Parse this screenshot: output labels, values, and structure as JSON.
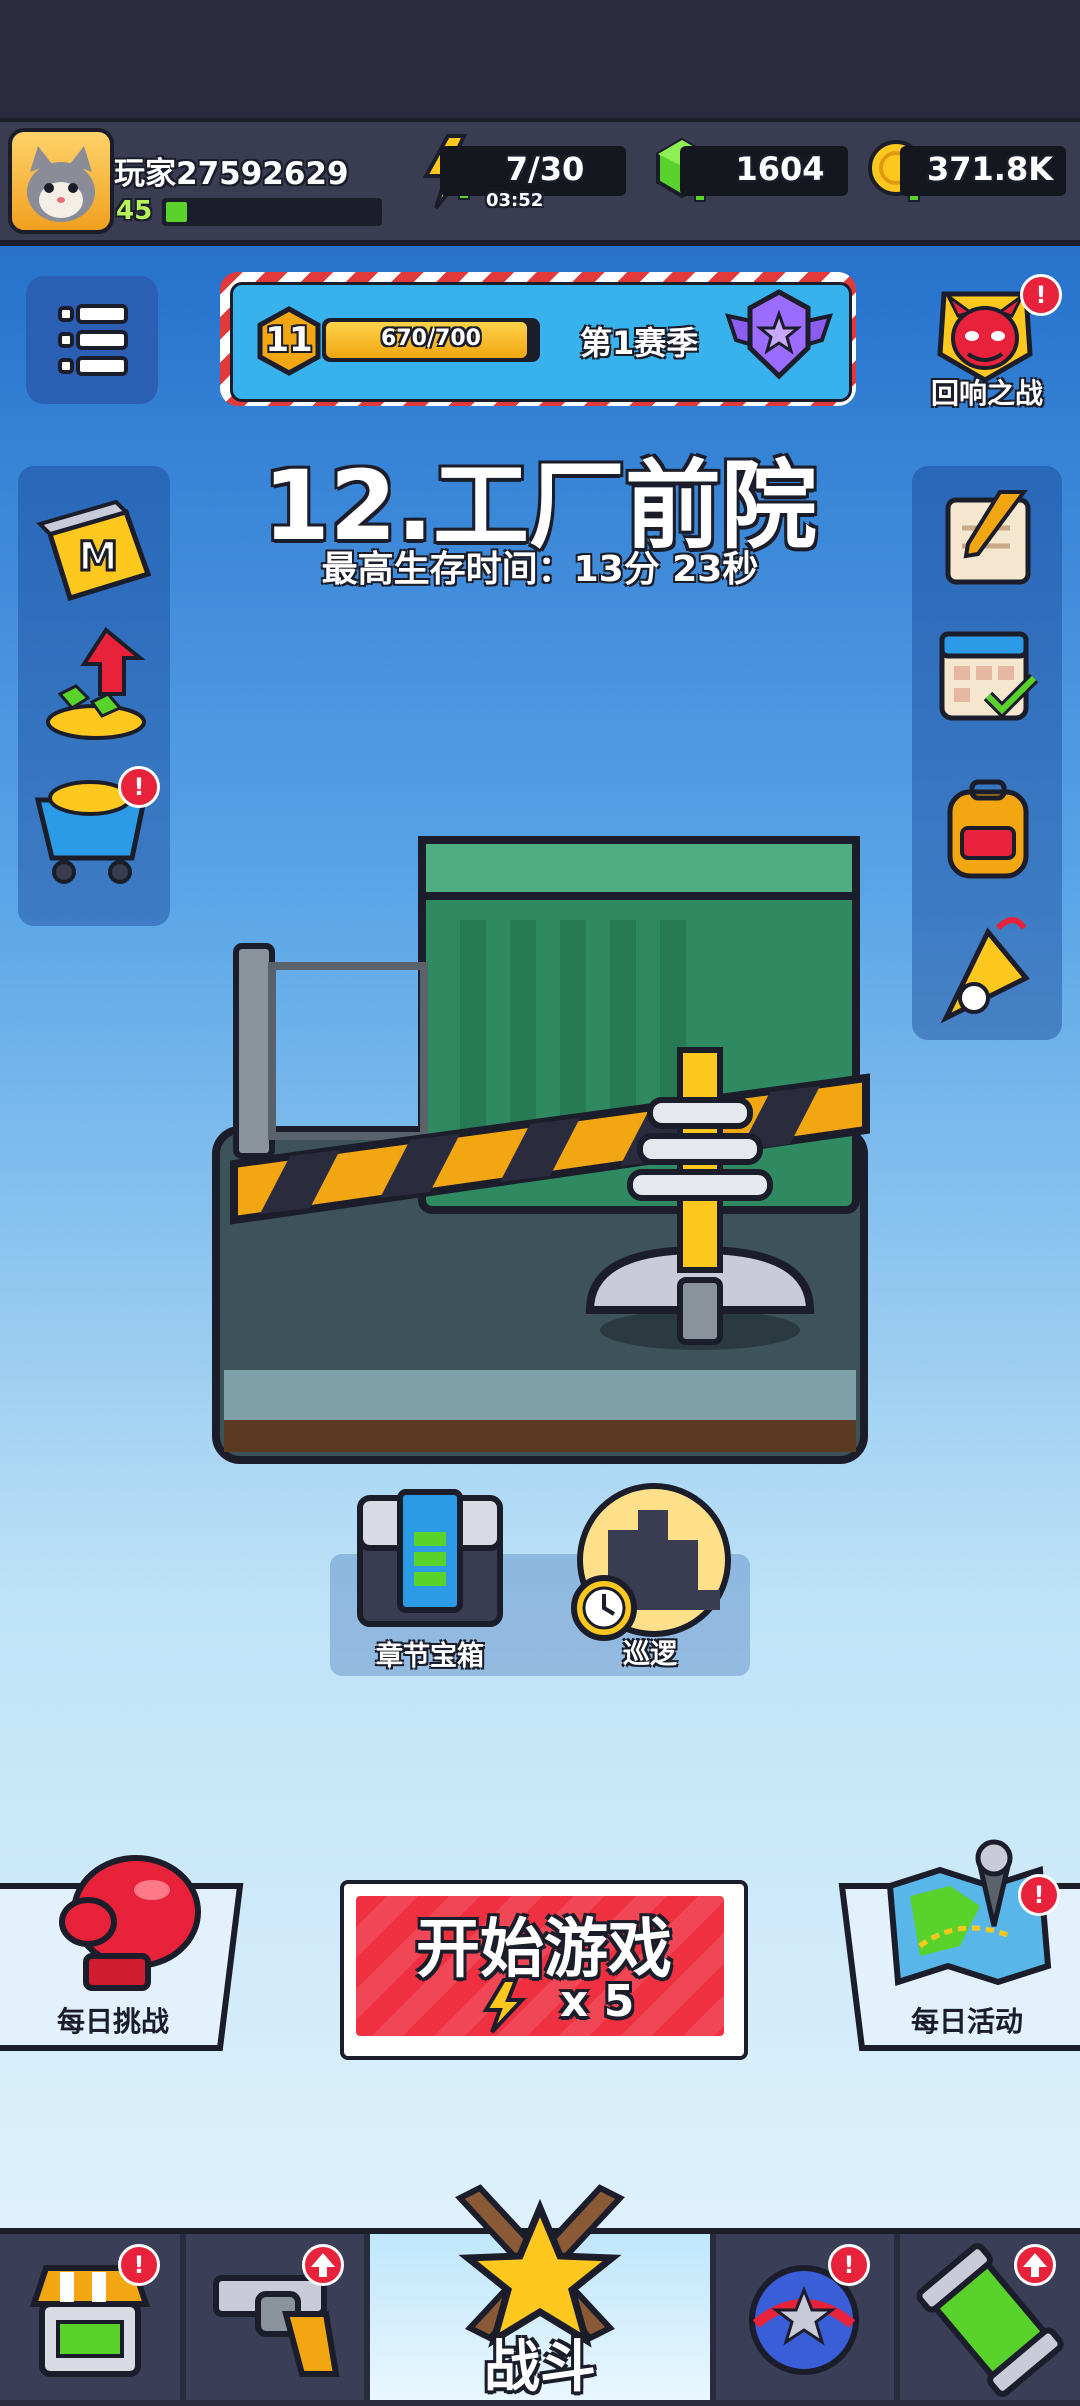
{
  "player": {
    "name": "玩家27592629",
    "level": "45",
    "xp_fraction": 0.1
  },
  "resources": {
    "energy": "7/30",
    "energy_timer": "03:52",
    "gems": "1604",
    "coins": "371.8K"
  },
  "season": {
    "level": "11",
    "progress": "670/700",
    "progress_fraction": 0.957,
    "name": "第1赛季"
  },
  "echo_battle": {
    "label": "回响之战"
  },
  "chapter": {
    "title": "12.工厂前院",
    "best_time": "最高生存时间：13分 23秒"
  },
  "rewards": {
    "chest_label": "章节宝箱",
    "patrol_label": "巡逻"
  },
  "actions": {
    "daily_challenge": "每日挑战",
    "daily_event": "每日活动",
    "start_label": "开始游戏",
    "start_cost": "x 5"
  },
  "nav": {
    "battle": "战斗"
  },
  "badges": {
    "alert": "!"
  },
  "colors": {
    "accent_red": "#ee3040",
    "gem_green": "#59d22b",
    "coin_gold": "#f2a612",
    "season_blue": "#38b2ec"
  }
}
